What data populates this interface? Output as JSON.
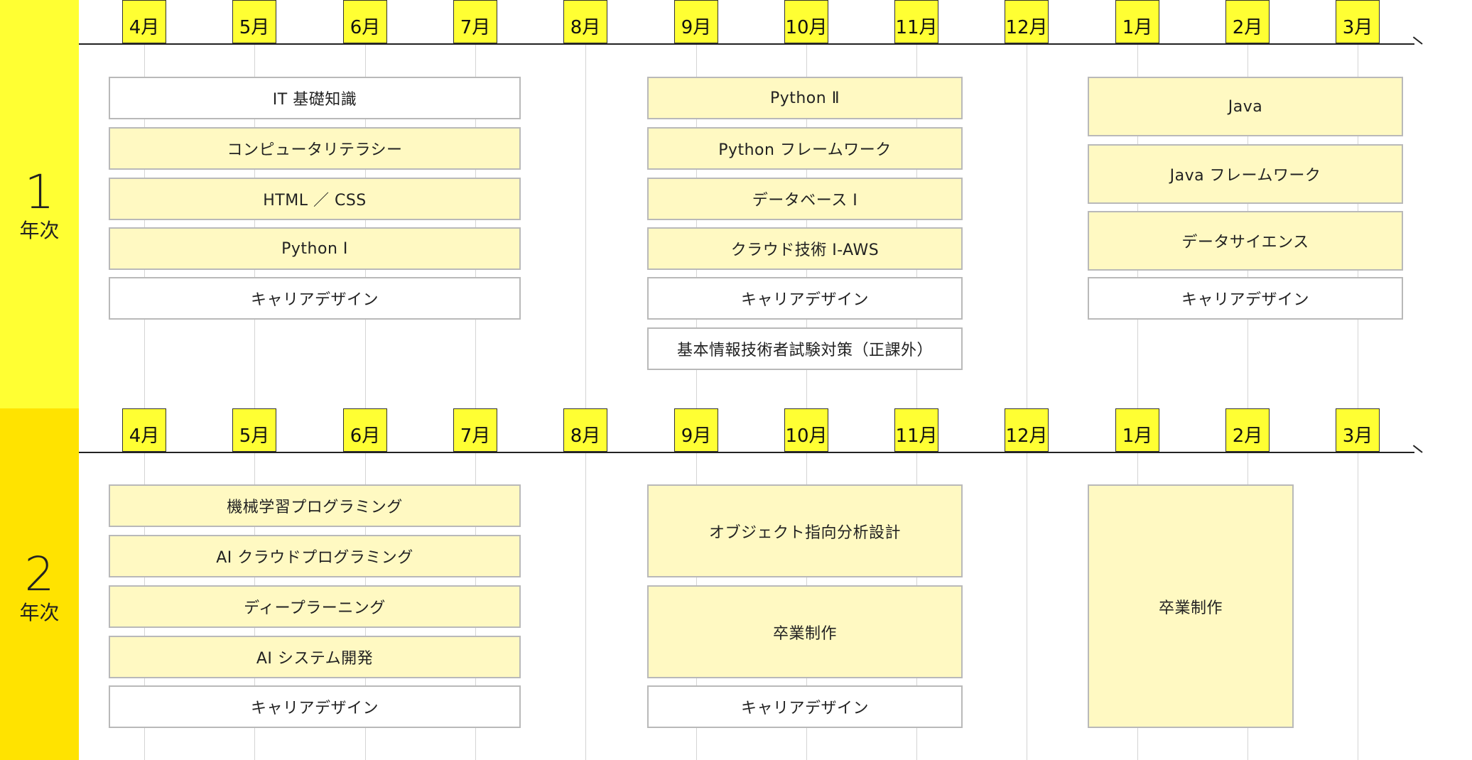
{
  "colors": {
    "year1_band": "#ffff33",
    "year2_band": "#ffe300",
    "month_tag": "#ffff33",
    "course_fill": "#fff9c2",
    "course_plain": "#ffffff"
  },
  "years": [
    {
      "number": "1",
      "suffix": "年次",
      "months": [
        "4月",
        "5月",
        "6月",
        "7月",
        "8月",
        "9月",
        "10月",
        "11月",
        "12月",
        "1月",
        "2月",
        "3月"
      ],
      "courses": [
        {
          "label": "IT 基礎知識",
          "style": "white"
        },
        {
          "label": "コンピュータリテラシー",
          "style": "core"
        },
        {
          "label": "HTML ／ CSS",
          "style": "core"
        },
        {
          "label": "Python Ⅰ",
          "style": "core"
        },
        {
          "label": "キャリアデザイン",
          "style": "white"
        },
        {
          "label": "Python Ⅱ",
          "style": "core"
        },
        {
          "label": "Python フレームワーク",
          "style": "core"
        },
        {
          "label": "データベース Ⅰ",
          "style": "core"
        },
        {
          "label": "クラウド技術 Ⅰ-AWS",
          "style": "core"
        },
        {
          "label": "キャリアデザイン",
          "style": "white"
        },
        {
          "label": "基本情報技術者試験対策（正課外）",
          "style": "white"
        },
        {
          "label": "Java",
          "style": "core"
        },
        {
          "label": "Java フレームワーク",
          "style": "core"
        },
        {
          "label": "データサイエンス",
          "style": "core"
        },
        {
          "label": "キャリアデザイン",
          "style": "white"
        }
      ]
    },
    {
      "number": "2",
      "suffix": "年次",
      "months": [
        "4月",
        "5月",
        "6月",
        "7月",
        "8月",
        "9月",
        "10月",
        "11月",
        "12月",
        "1月",
        "2月",
        "3月"
      ],
      "courses": [
        {
          "label": "機械学習プログラミング",
          "style": "core"
        },
        {
          "label": "AI クラウドプログラミング",
          "style": "core"
        },
        {
          "label": "ディープラーニング",
          "style": "core"
        },
        {
          "label": "AI システム開発",
          "style": "core"
        },
        {
          "label": "キャリアデザイン",
          "style": "white"
        },
        {
          "label": "オブジェクト指向分析設計",
          "style": "core"
        },
        {
          "label": "卒業制作",
          "style": "core"
        },
        {
          "label": "キャリアデザイン",
          "style": "white"
        },
        {
          "label": "卒業制作",
          "style": "core"
        }
      ]
    }
  ]
}
